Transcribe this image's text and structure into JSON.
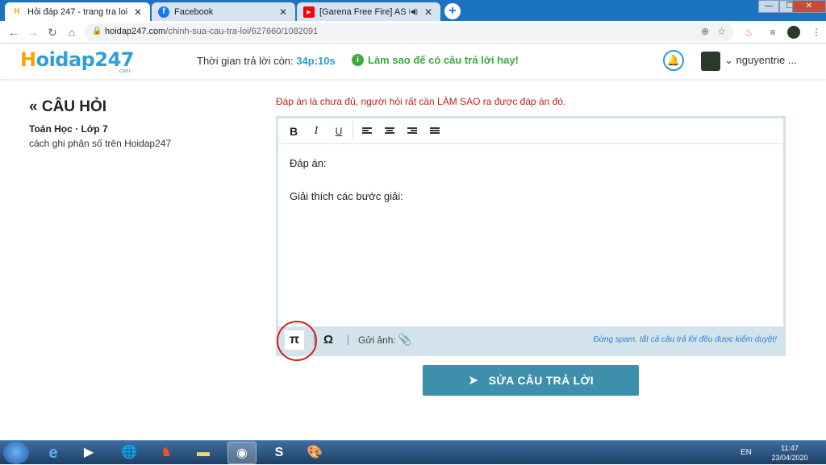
{
  "browser": {
    "tabs": [
      {
        "title": "Hỏi đáp 247 - trang tra loi",
        "favicon": "hoidap-icon",
        "active": true
      },
      {
        "title": "Facebook",
        "favicon": "facebook-icon",
        "active": false
      },
      {
        "title": "[Garena Free Fire] AS Kéo Tâ",
        "favicon": "youtube-icon",
        "active": false,
        "audio": true
      }
    ],
    "new_tab": "+",
    "url_host": "hoidap247.com",
    "url_path": "/chinh-sua-cau-tra-loi/627660/1082091",
    "window_controls": {
      "minimize": "—",
      "restore": "❐",
      "close": "✕"
    }
  },
  "header": {
    "logo_h": "H",
    "logo_rest": "oidap247",
    "logo_sub": ".com",
    "timer_label": "Thời gian trả lời còn:",
    "timer_value": "34p:10s",
    "hint": "Làm sao để có câu trả lời hay!",
    "username": "nguyentrie ..."
  },
  "question": {
    "back_title": "« CÂU HỎI",
    "subject": "Toán Học · Lớp 7",
    "text": "cách ghi phân số trên Hoidap247"
  },
  "editor": {
    "warning": "Đáp án là chưa đủ, người hỏi rất cần LÀM SAO ra được đáp án đó.",
    "toolbar": {
      "bold": "B",
      "italic": "I",
      "underline": "U"
    },
    "content_line1": "Đáp án:",
    "content_line2": "Giải thích các bước giải:",
    "bottom": {
      "pi": "π",
      "omega": "Ω",
      "upload_label": "Gửi ảnh:",
      "spam_note": "Đừng spam, tất cả câu trả lời đều được kiểm duyệt!"
    }
  },
  "submit_label": "SỬA CÂU TRẢ LỜI",
  "taskbar": {
    "apps": [
      "ie-icon",
      "media-player-icon",
      "network-icon",
      "brave-icon",
      "folder-icon",
      "chrome-icon",
      "skype-icon",
      "paint-icon"
    ],
    "lang": "EN",
    "time": "11:47",
    "date": "23/04/2020"
  },
  "colors": {
    "tab_strip": "#1e73be",
    "accent": "#2a9bd8",
    "green": "#3fa83f",
    "warning": "#b8241b",
    "submit": "#3d8fab",
    "highlight_circle": "#d0201b"
  }
}
